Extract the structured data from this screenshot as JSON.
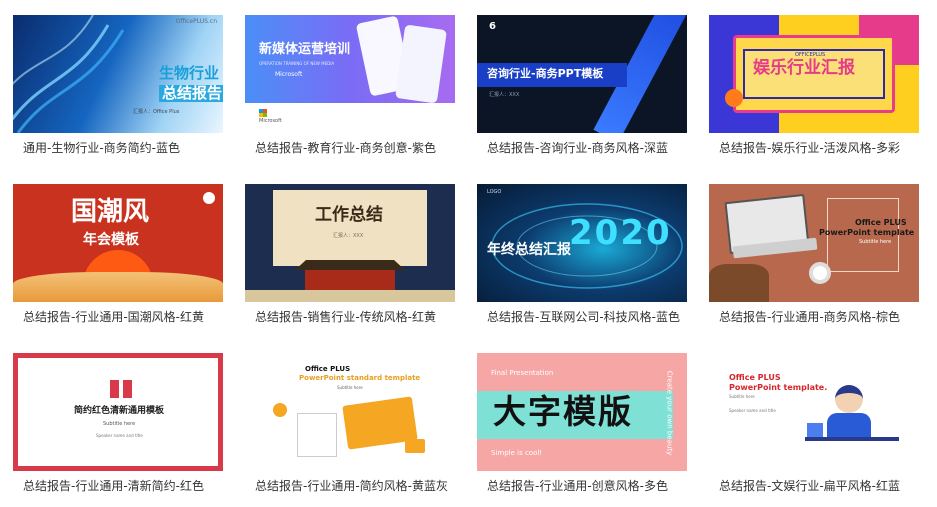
{
  "templates": [
    {
      "caption": "通用-生物行业-商务简约-蓝色",
      "title_line1": "生物行业",
      "title_line2": "总结报告",
      "brand": "OfficePLUS.cn",
      "meta": "汇报人：Office Plus"
    },
    {
      "caption": "总结报告-教育行业-商务创意-紫色",
      "title": "新媒体运营培训",
      "subtitle": "OPERATION TRAINING OF NEW MEDIA",
      "sponsor": "Microsoft",
      "footer_logo": "Microsoft"
    },
    {
      "caption": "总结报告-咨询行业-商务风格-深蓝",
      "title": "咨询行业-商务PPT模板",
      "meta": "汇报人：XXX",
      "logo": "6"
    },
    {
      "caption": "总结报告-娱乐行业-活泼风格-多彩",
      "title": "娱乐行业汇报",
      "badge": "OFFICEPLUS"
    },
    {
      "caption": "总结报告-行业通用-国潮风格-红黄",
      "title": "国潮风",
      "subtitle": "年会模板"
    },
    {
      "caption": "总结报告-销售行业-传统风格-红黄",
      "title": "工作总结",
      "meta": "汇报人：XXX"
    },
    {
      "caption": "总结报告-互联网公司-科技风格-蓝色",
      "title": "年终总结汇报",
      "year": "2020",
      "logo": "LOGO"
    },
    {
      "caption": "总结报告-行业通用-商务风格-棕色",
      "title_line1": "Office PLUS",
      "title_line2": "PowerPoint template",
      "subtitle": "Subtitle here"
    },
    {
      "caption": "总结报告-行业通用-清新简约-红色",
      "title": "简约红色清新通用模板",
      "subtitle": "Subtitle here",
      "meta": "Speaker name and title"
    },
    {
      "caption": "总结报告-行业通用-简约风格-黄蓝灰",
      "title_line1": "Office PLUS",
      "title_line2": "PowerPoint standard template",
      "subtitle": "Subtitle here"
    },
    {
      "caption": "总结报告-行业通用-创意风格-多色",
      "title": "大字模版",
      "top_text": "Final Presentation",
      "bottom_text": "Simple is cool!",
      "side_text": "Create your own beauty"
    },
    {
      "caption": "总结报告-文娱行业-扁平风格-红蓝",
      "title_line1": "Office PLUS",
      "title_line2": "PowerPoint template.",
      "subtitle": "Subtitle here",
      "meta": "Speaker name and title"
    }
  ],
  "colors": {
    "caption_text": "#333333",
    "page_bg": "#ffffff"
  }
}
